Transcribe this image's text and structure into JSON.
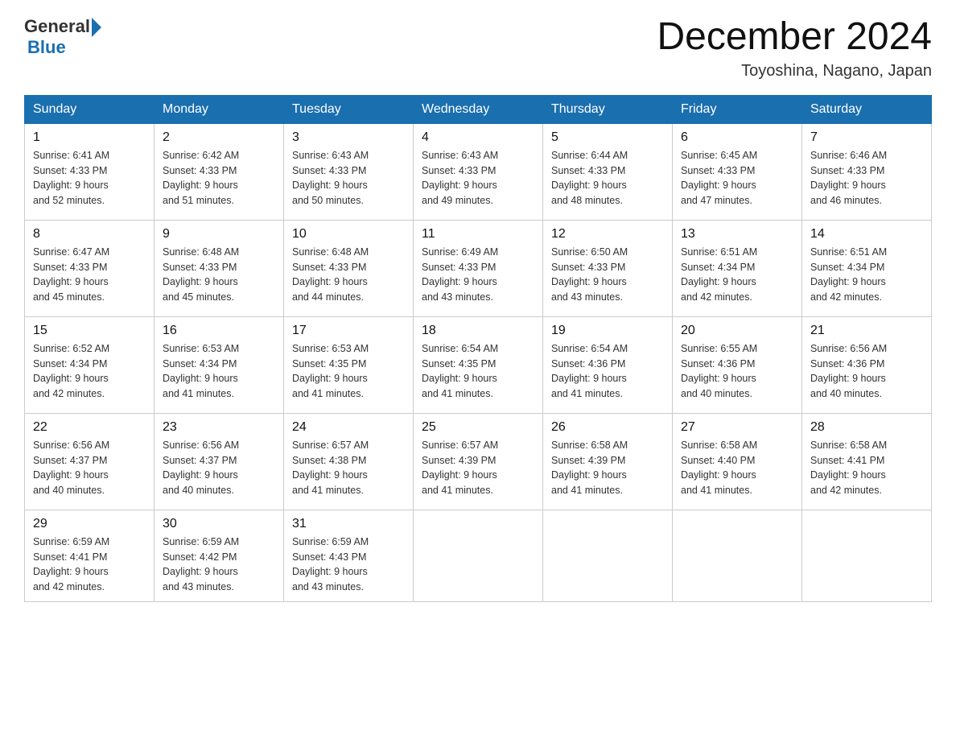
{
  "header": {
    "logo_general": "General",
    "logo_blue": "Blue",
    "title": "December 2024",
    "location": "Toyoshina, Nagano, Japan"
  },
  "days_of_week": [
    "Sunday",
    "Monday",
    "Tuesday",
    "Wednesday",
    "Thursday",
    "Friday",
    "Saturday"
  ],
  "weeks": [
    [
      {
        "day": "1",
        "sunrise": "6:41 AM",
        "sunset": "4:33 PM",
        "daylight": "9 hours and 52 minutes."
      },
      {
        "day": "2",
        "sunrise": "6:42 AM",
        "sunset": "4:33 PM",
        "daylight": "9 hours and 51 minutes."
      },
      {
        "day": "3",
        "sunrise": "6:43 AM",
        "sunset": "4:33 PM",
        "daylight": "9 hours and 50 minutes."
      },
      {
        "day": "4",
        "sunrise": "6:43 AM",
        "sunset": "4:33 PM",
        "daylight": "9 hours and 49 minutes."
      },
      {
        "day": "5",
        "sunrise": "6:44 AM",
        "sunset": "4:33 PM",
        "daylight": "9 hours and 48 minutes."
      },
      {
        "day": "6",
        "sunrise": "6:45 AM",
        "sunset": "4:33 PM",
        "daylight": "9 hours and 47 minutes."
      },
      {
        "day": "7",
        "sunrise": "6:46 AM",
        "sunset": "4:33 PM",
        "daylight": "9 hours and 46 minutes."
      }
    ],
    [
      {
        "day": "8",
        "sunrise": "6:47 AM",
        "sunset": "4:33 PM",
        "daylight": "9 hours and 45 minutes."
      },
      {
        "day": "9",
        "sunrise": "6:48 AM",
        "sunset": "4:33 PM",
        "daylight": "9 hours and 45 minutes."
      },
      {
        "day": "10",
        "sunrise": "6:48 AM",
        "sunset": "4:33 PM",
        "daylight": "9 hours and 44 minutes."
      },
      {
        "day": "11",
        "sunrise": "6:49 AM",
        "sunset": "4:33 PM",
        "daylight": "9 hours and 43 minutes."
      },
      {
        "day": "12",
        "sunrise": "6:50 AM",
        "sunset": "4:33 PM",
        "daylight": "9 hours and 43 minutes."
      },
      {
        "day": "13",
        "sunrise": "6:51 AM",
        "sunset": "4:34 PM",
        "daylight": "9 hours and 42 minutes."
      },
      {
        "day": "14",
        "sunrise": "6:51 AM",
        "sunset": "4:34 PM",
        "daylight": "9 hours and 42 minutes."
      }
    ],
    [
      {
        "day": "15",
        "sunrise": "6:52 AM",
        "sunset": "4:34 PM",
        "daylight": "9 hours and 42 minutes."
      },
      {
        "day": "16",
        "sunrise": "6:53 AM",
        "sunset": "4:34 PM",
        "daylight": "9 hours and 41 minutes."
      },
      {
        "day": "17",
        "sunrise": "6:53 AM",
        "sunset": "4:35 PM",
        "daylight": "9 hours and 41 minutes."
      },
      {
        "day": "18",
        "sunrise": "6:54 AM",
        "sunset": "4:35 PM",
        "daylight": "9 hours and 41 minutes."
      },
      {
        "day": "19",
        "sunrise": "6:54 AM",
        "sunset": "4:36 PM",
        "daylight": "9 hours and 41 minutes."
      },
      {
        "day": "20",
        "sunrise": "6:55 AM",
        "sunset": "4:36 PM",
        "daylight": "9 hours and 40 minutes."
      },
      {
        "day": "21",
        "sunrise": "6:56 AM",
        "sunset": "4:36 PM",
        "daylight": "9 hours and 40 minutes."
      }
    ],
    [
      {
        "day": "22",
        "sunrise": "6:56 AM",
        "sunset": "4:37 PM",
        "daylight": "9 hours and 40 minutes."
      },
      {
        "day": "23",
        "sunrise": "6:56 AM",
        "sunset": "4:37 PM",
        "daylight": "9 hours and 40 minutes."
      },
      {
        "day": "24",
        "sunrise": "6:57 AM",
        "sunset": "4:38 PM",
        "daylight": "9 hours and 41 minutes."
      },
      {
        "day": "25",
        "sunrise": "6:57 AM",
        "sunset": "4:39 PM",
        "daylight": "9 hours and 41 minutes."
      },
      {
        "day": "26",
        "sunrise": "6:58 AM",
        "sunset": "4:39 PM",
        "daylight": "9 hours and 41 minutes."
      },
      {
        "day": "27",
        "sunrise": "6:58 AM",
        "sunset": "4:40 PM",
        "daylight": "9 hours and 41 minutes."
      },
      {
        "day": "28",
        "sunrise": "6:58 AM",
        "sunset": "4:41 PM",
        "daylight": "9 hours and 42 minutes."
      }
    ],
    [
      {
        "day": "29",
        "sunrise": "6:59 AM",
        "sunset": "4:41 PM",
        "daylight": "9 hours and 42 minutes."
      },
      {
        "day": "30",
        "sunrise": "6:59 AM",
        "sunset": "4:42 PM",
        "daylight": "9 hours and 43 minutes."
      },
      {
        "day": "31",
        "sunrise": "6:59 AM",
        "sunset": "4:43 PM",
        "daylight": "9 hours and 43 minutes."
      },
      {
        "day": "",
        "sunrise": "",
        "sunset": "",
        "daylight": ""
      },
      {
        "day": "",
        "sunrise": "",
        "sunset": "",
        "daylight": ""
      },
      {
        "day": "",
        "sunrise": "",
        "sunset": "",
        "daylight": ""
      },
      {
        "day": "",
        "sunrise": "",
        "sunset": "",
        "daylight": ""
      }
    ]
  ],
  "labels": {
    "sunrise": "Sunrise:",
    "sunset": "Sunset:",
    "daylight": "Daylight:"
  }
}
